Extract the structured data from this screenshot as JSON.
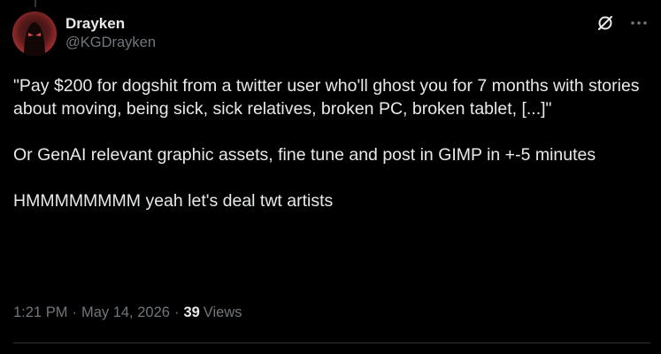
{
  "author": {
    "display_name": "Drayken",
    "handle": "@KGDrayken",
    "avatar": "red-masked-figure-avatar"
  },
  "header_icons": {
    "grok": "grok-slash-icon",
    "more": "more-dots-icon",
    "more_glyph": "···"
  },
  "tweet": {
    "paragraphs": [
      "\"Pay $200 for dogshit from a twitter user who'll ghost you for 7 months with stories about moving, being sick, sick relatives, broken PC, broken tablet, [...]\"",
      "Or GenAI relevant graphic assets, fine tune and post in GIMP in +-5 minutes",
      "HMMMMMMMM yeah let's deal twt artists"
    ]
  },
  "meta": {
    "time": "1:21 PM",
    "separator": "·",
    "date": "May 14, 2026",
    "views_count": "39",
    "views_label": "Views"
  },
  "colors": {
    "background": "#000000",
    "text": "#e7e9ea",
    "secondary": "#71767b",
    "divider": "#2f3336"
  }
}
